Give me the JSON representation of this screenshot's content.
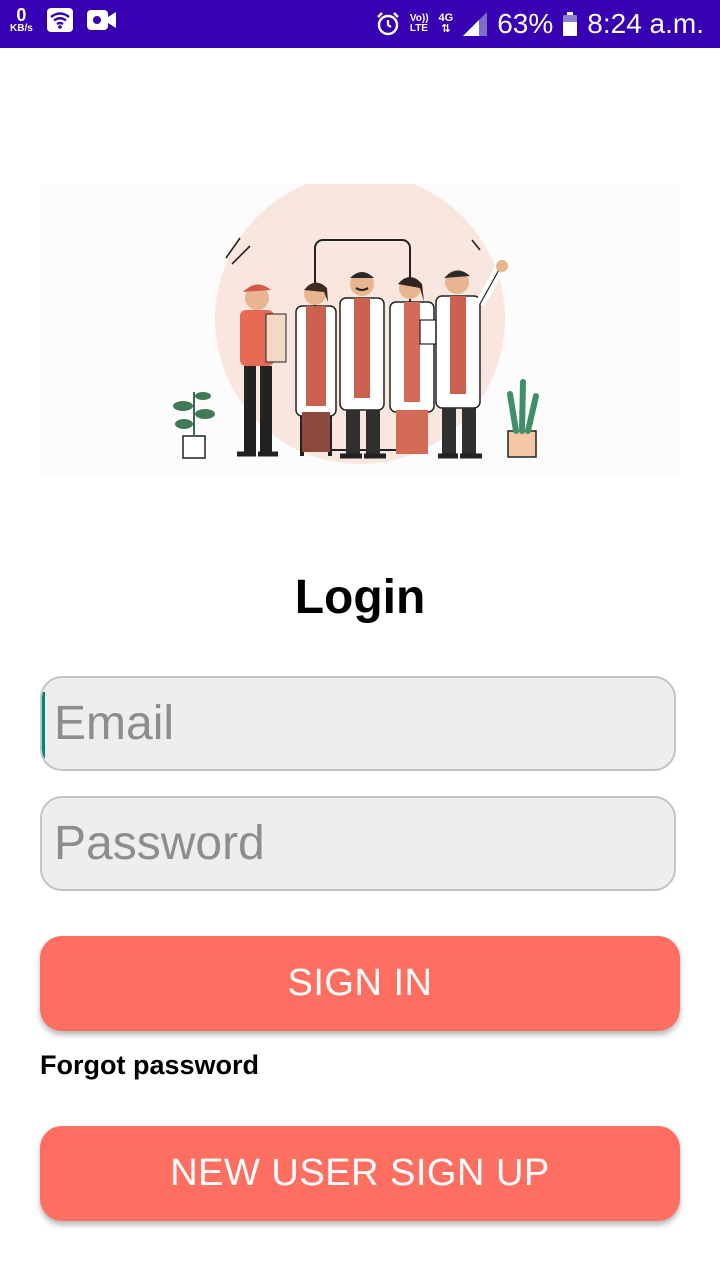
{
  "status_bar": {
    "kbs_value": "0",
    "kbs_unit": "KB/s",
    "volte_top": "Vo))",
    "volte_bottom": "LTE",
    "network": "4G",
    "network_arrows": "⇅",
    "battery": "63%",
    "time": "8:24 a.m.",
    "background_color": "#3700b3"
  },
  "login": {
    "title": "Login",
    "email_placeholder": "Email",
    "password_placeholder": "Password",
    "sign_in_label": "SIGN IN",
    "forgot_password_label": "Forgot password",
    "sign_up_label": "NEW USER SIGN UP",
    "accent_color": "#ff6f61"
  },
  "illustration": {
    "subject": "healthcare-team-illustration"
  }
}
